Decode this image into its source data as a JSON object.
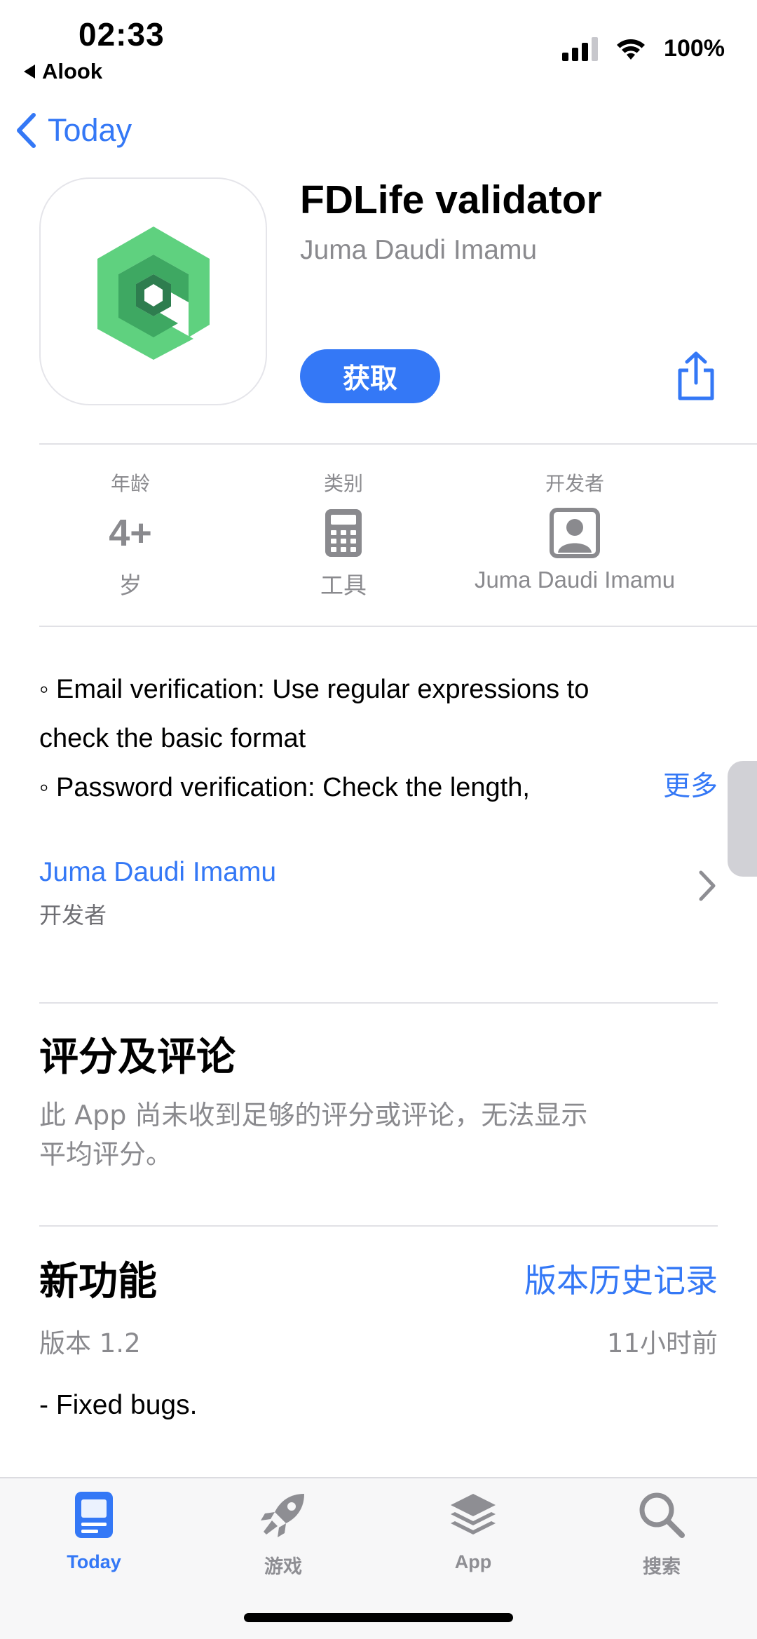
{
  "status_bar": {
    "time": "02:33",
    "back_app": "Alook",
    "battery": "100%"
  },
  "nav": {
    "back_label": "Today"
  },
  "app": {
    "title": "FDLife validator",
    "developer": "Juma Daudi Imamu",
    "get_label": "获取",
    "icon": "app-logo-icon"
  },
  "info": {
    "age_label": "年龄",
    "age_value": "4+",
    "age_unit": "岁",
    "category_label": "类别",
    "category_value": "工具",
    "category_icon": "calculator-icon",
    "developer_label": "开发者",
    "developer_value": "Juma Daudi Imamu",
    "developer_icon": "person-icon"
  },
  "description": {
    "line1": "◦ Email verification: Use regular expressions to",
    "line2": "check the basic format",
    "line3": "◦ Password verification: Check the length,",
    "more_label": "更多"
  },
  "developer_row": {
    "name": "Juma Daudi Imamu",
    "sub": "开发者"
  },
  "ratings": {
    "title": "评分及评论",
    "text_line1": "此 App 尚未收到足够的评分或评论，无法显示",
    "text_line2": "平均评分。"
  },
  "whats_new": {
    "title": "新功能",
    "history_label": "版本历史记录",
    "version": "版本 1.2",
    "time_ago": "11小时前",
    "notes": "- Fixed bugs."
  },
  "tabs": [
    {
      "label": "Today",
      "icon": "today-icon",
      "active": true
    },
    {
      "label": "游戏",
      "icon": "rocket-icon",
      "active": false
    },
    {
      "label": "App",
      "icon": "stack-icon",
      "active": false
    },
    {
      "label": "搜索",
      "icon": "search-icon",
      "active": false
    }
  ],
  "colors": {
    "accent": "#3478f6",
    "secondary_text": "#8a8a8e",
    "logo_green_light": "#5fd17f",
    "logo_green_dark": "#2e7d4f"
  }
}
